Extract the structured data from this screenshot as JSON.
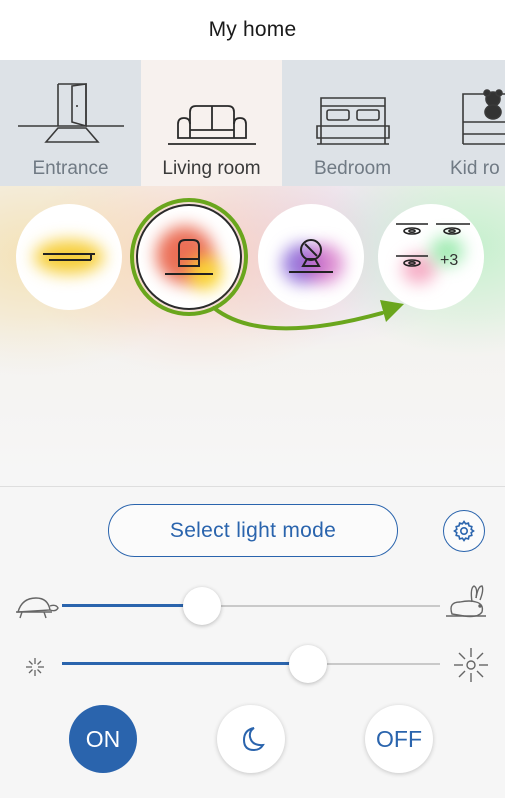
{
  "header": {
    "title": "My home"
  },
  "rooms": [
    {
      "label": "Entrance",
      "icon": "door-icon",
      "active": false
    },
    {
      "label": "Living room",
      "icon": "sofa-icon",
      "active": true
    },
    {
      "label": "Bedroom",
      "icon": "bed-icon",
      "active": false
    },
    {
      "label": "Kid ro",
      "icon": "kid-bed-icon",
      "active": false
    }
  ],
  "lights": [
    {
      "icon": "linear-lamp-icon",
      "glow": "#f5c518",
      "selected": false
    },
    {
      "icon": "wall-lamp-icon",
      "glow": "#e8563a",
      "selected": true
    },
    {
      "icon": "mirror-lamp-icon",
      "glow": "#9a4fd0",
      "selected": false
    },
    {
      "icon": "ceiling-spots-icon",
      "extra_count": "+3",
      "selected": false
    }
  ],
  "controls": {
    "mode_button_label": "Select light mode",
    "settings_icon": "gear-icon",
    "speed_slider": {
      "value": 0.37,
      "min_icon": "turtle-icon",
      "max_icon": "rabbit-icon"
    },
    "brightness_slider": {
      "value": 0.65,
      "min_icon": "dim-sun-icon",
      "max_icon": "bright-sun-icon"
    },
    "on_label": "ON",
    "night_icon": "moon-icon",
    "off_label": "OFF"
  },
  "colors": {
    "accent": "#2a64ad",
    "selection": "#6aa61d"
  }
}
